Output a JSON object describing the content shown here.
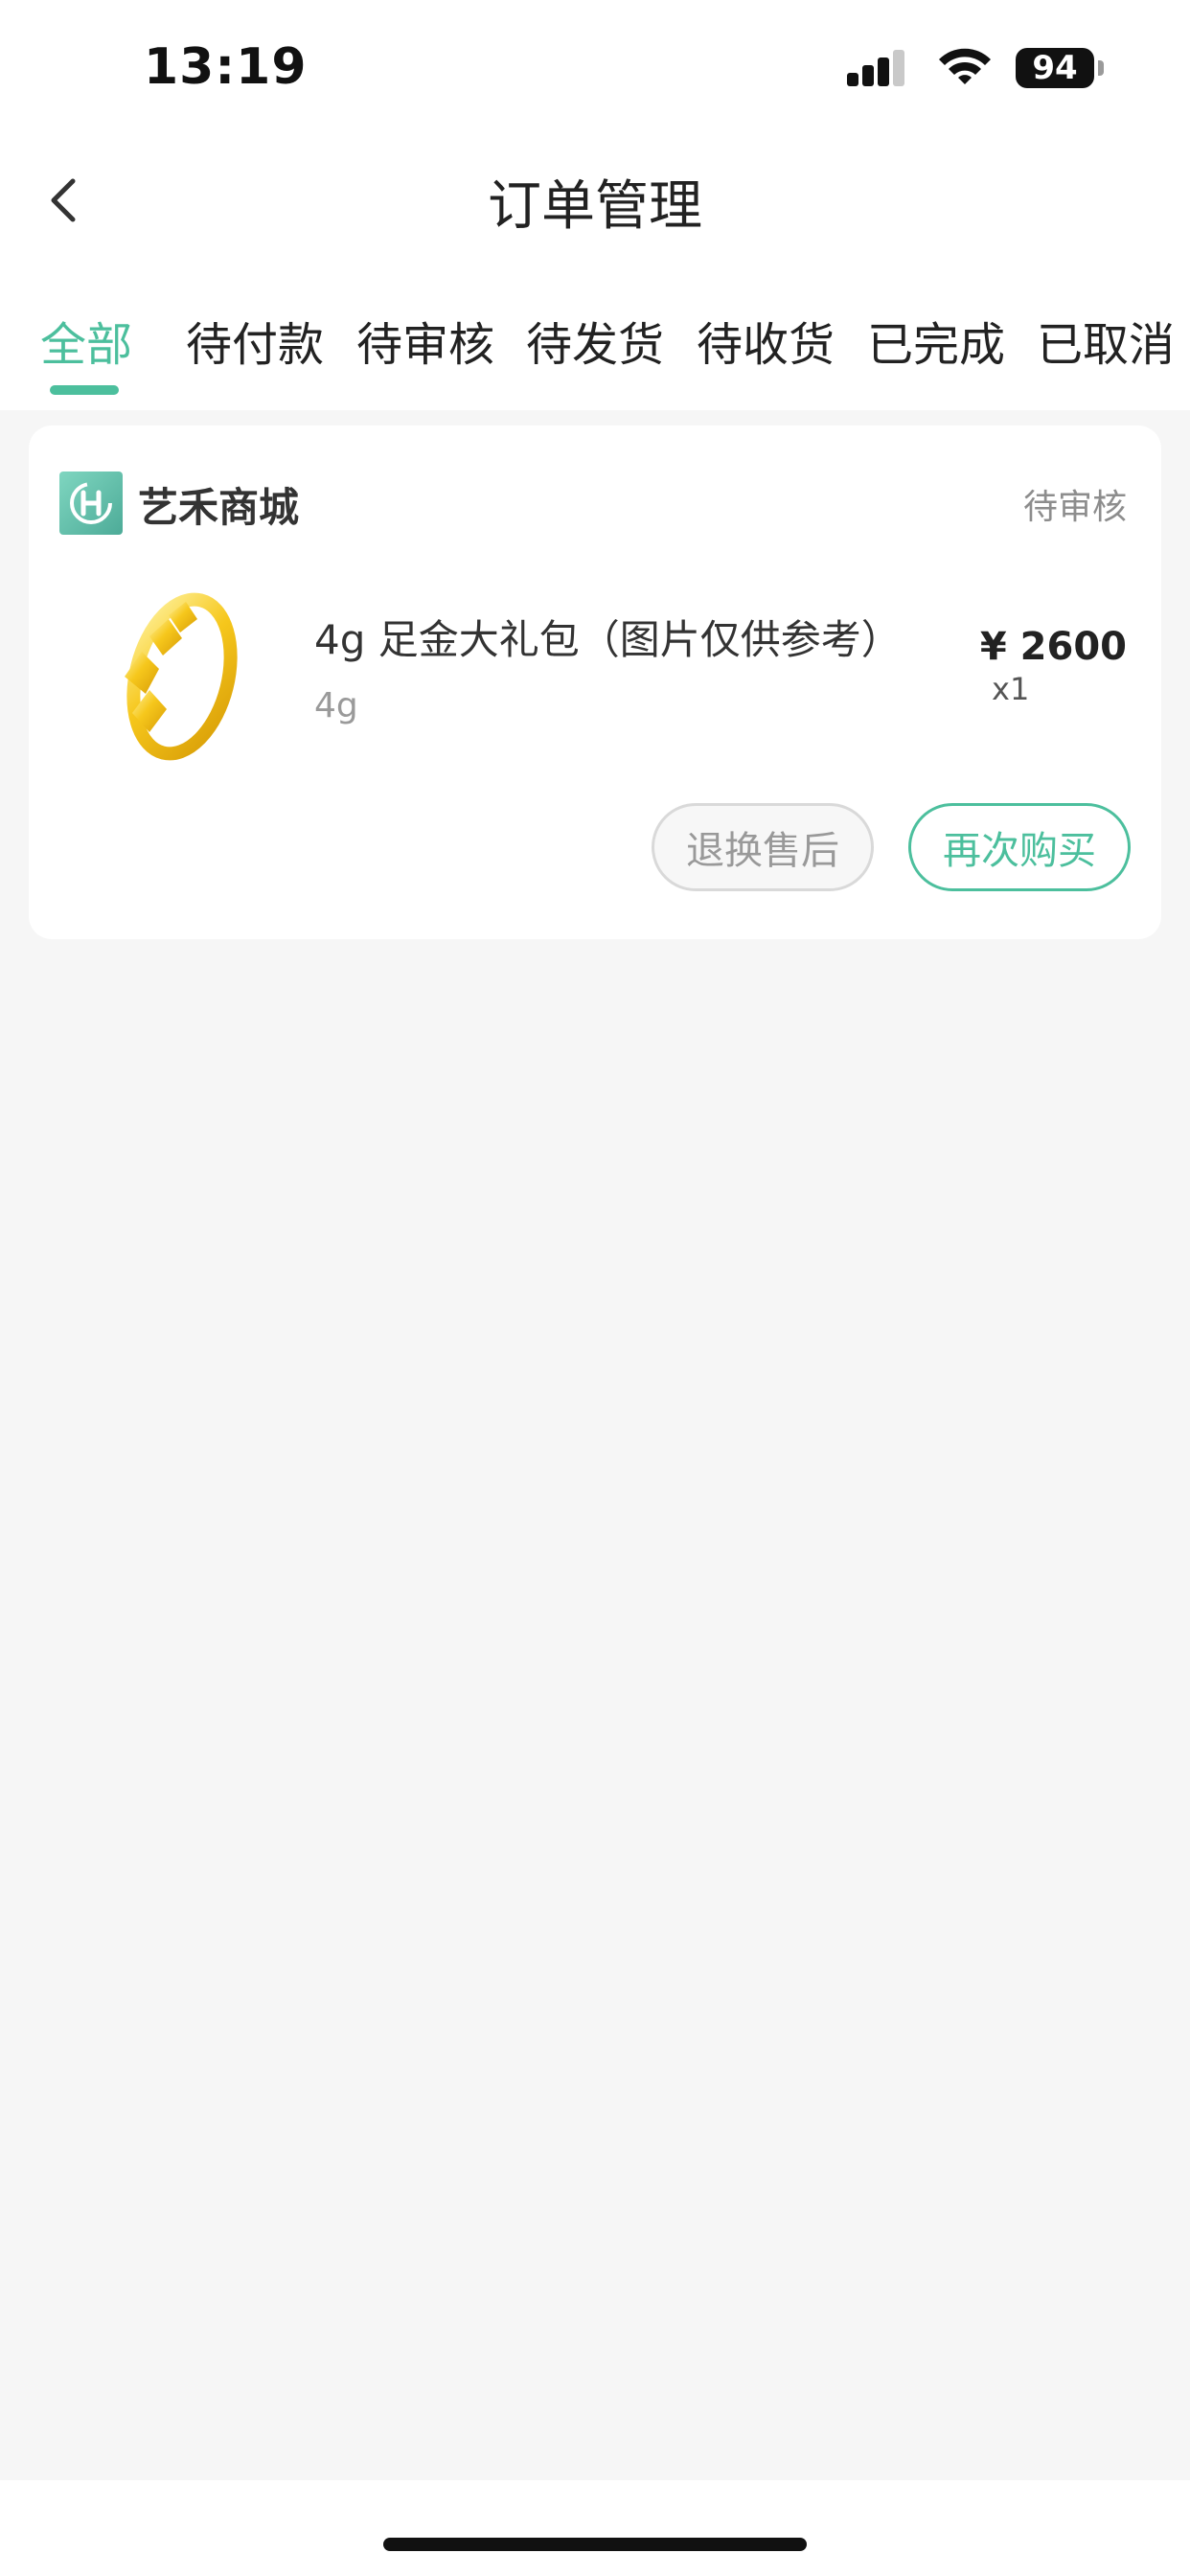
{
  "status_bar": {
    "time": "13:19",
    "battery": "94",
    "icons": [
      "signal-icon",
      "wifi-icon",
      "battery-icon"
    ]
  },
  "header": {
    "title": "订单管理",
    "back_icon": "chevron-left-icon"
  },
  "tabs": [
    {
      "label": "全部",
      "active": true
    },
    {
      "label": "待付款",
      "active": false
    },
    {
      "label": "待审核",
      "active": false
    },
    {
      "label": "待发货",
      "active": false
    },
    {
      "label": "待收货",
      "active": false
    },
    {
      "label": "已完成",
      "active": false
    },
    {
      "label": "已取消",
      "active": false
    }
  ],
  "orders": [
    {
      "shop_name": "艺禾商城",
      "status": "待审核",
      "product_name": "4g 足金大礼包（图片仅供参考）",
      "spec": "4g",
      "price": "¥ 2600",
      "quantity": "x1",
      "buttons": {
        "return": "退换售后",
        "rebuy": "再次购买"
      }
    }
  ],
  "colors": {
    "accent": "#4cbf9d",
    "background": "#f6f6f6",
    "card": "#ffffff",
    "gold": "#f2c21a"
  }
}
